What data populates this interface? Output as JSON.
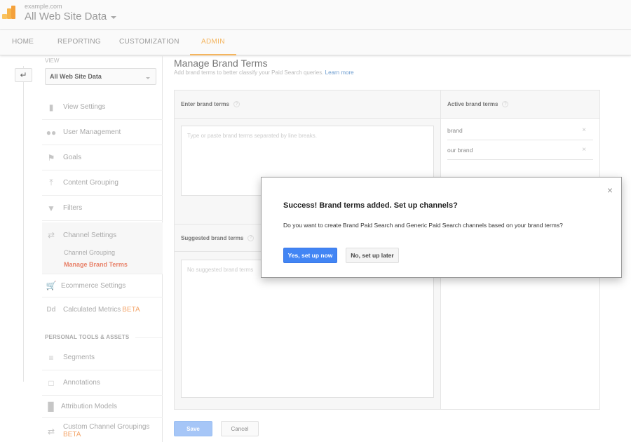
{
  "header": {
    "account": "example.com",
    "property": "All Web Site Data"
  },
  "nav": {
    "tabs": [
      {
        "label": "HOME",
        "active": false
      },
      {
        "label": "REPORTING",
        "active": false
      },
      {
        "label": "CUSTOMIZATION",
        "active": false
      },
      {
        "label": "ADMIN",
        "active": true
      }
    ]
  },
  "sidebar": {
    "view_label": "VIEW",
    "view_selected": "All Web Site Data",
    "items": [
      {
        "label": "View Settings",
        "icon": "document-icon"
      },
      {
        "label": "User Management",
        "icon": "users-icon"
      },
      {
        "label": "Goals",
        "icon": "flag-icon"
      },
      {
        "label": "Content Grouping",
        "icon": "merge-icon"
      },
      {
        "label": "Filters",
        "icon": "filter-icon"
      },
      {
        "label": "Channel Settings",
        "icon": "channel-icon"
      },
      {
        "label": "Ecommerce Settings",
        "icon": "cart-icon"
      },
      {
        "label": "Calculated Metrics",
        "icon": "dd-icon",
        "badge": "BETA"
      }
    ],
    "channel_sub": [
      {
        "label": "Channel Grouping",
        "active": false
      },
      {
        "label": "Manage Brand Terms",
        "active": true
      }
    ],
    "section_personal": "PERSONAL TOOLS & ASSETS",
    "personal_items": [
      {
        "label": "Segments",
        "icon": "segments-icon"
      },
      {
        "label": "Annotations",
        "icon": "annotation-icon"
      },
      {
        "label": "Attribution Models",
        "icon": "bar-chart-icon"
      },
      {
        "label": "Custom Channel Groupings",
        "icon": "channel-icon",
        "badge": "BETA"
      }
    ]
  },
  "main": {
    "title": "Manage Brand Terms",
    "subtitle": "Add brand terms to better classify your Paid Search queries.",
    "learn_more": "Learn more",
    "enter_label": "Enter brand terms",
    "enter_placeholder": "Type or paste brand terms separated by line breaks.",
    "suggested_label": "Suggested brand terms",
    "suggested_empty": "No suggested brand terms",
    "active_label": "Active brand terms",
    "active_terms": [
      "brand",
      "our brand"
    ],
    "help_glyph": "?",
    "remove_glyph": "×",
    "save_label": "Save",
    "cancel_label": "Cancel"
  },
  "dialog": {
    "title": "Success! Brand terms added. Set up channels?",
    "body": "Do you want to create Brand Paid Search and Generic Paid Search channels based on your brand terms?",
    "yes_label": "Yes, set up now",
    "no_label": "No, set up later",
    "close_glyph": "×"
  },
  "colors": {
    "accent_admin": "#f4b55f",
    "active_subitem": "#e8826a",
    "primary_button": "#4285f4",
    "beta": "#f4a56a",
    "link": "#6b9bcf"
  }
}
